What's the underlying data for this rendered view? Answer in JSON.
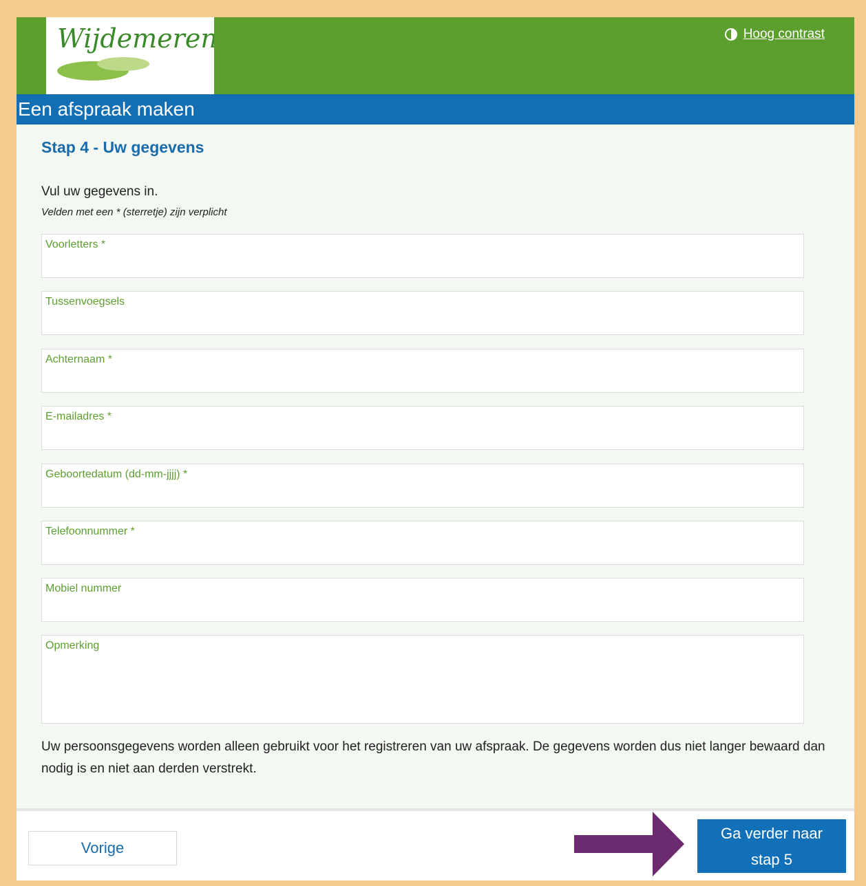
{
  "header": {
    "logo_text": "Wijdemeren",
    "contrast_link": "Hoog contrast"
  },
  "page_title": "Een afspraak maken",
  "step_title": "Stap 4 - Uw gegevens",
  "intro": "Vul uw gegevens in.",
  "required_note": "Velden met een * (sterretje) zijn verplicht",
  "fields": {
    "voorletters": "Voorletters *",
    "tussenvoegsels": "Tussenvoegsels",
    "achternaam": "Achternaam *",
    "email": "E-mailadres *",
    "geboortedatum": "Geboortedatum (dd-mm-jjjj) *",
    "telefoon": "Telefoonnummer *",
    "mobiel": "Mobiel nummer",
    "opmerking": "Opmerking"
  },
  "privacy_text": "Uw persoonsgegevens worden alleen gebruikt voor het registreren van uw afspraak. De gegevens worden dus niet langer bewaard dan nodig is en niet aan derden verstrekt.",
  "footer": {
    "prev_label": "Vorige",
    "next_line1": "Ga verder naar",
    "next_line2": "stap 5"
  },
  "colors": {
    "header_green": "#5c9f2e",
    "title_blue": "#136fb3",
    "arrow_purple": "#6b2b6e",
    "frame_orange": "#f6c98e"
  }
}
